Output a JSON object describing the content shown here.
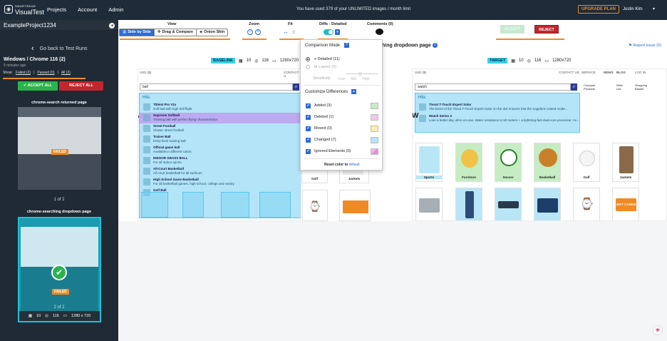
{
  "app": {
    "logo_small": "SMARTBEAR",
    "logo_big": "VisualTest",
    "logo_icon": "eye-icon",
    "nav": [
      "Projects",
      "Account",
      "Admin"
    ],
    "usage_text": "You have used 379 of your UNLIMITED images / month limit",
    "upgrade_label": "UPGRADE PLAN",
    "user_name": "Justin Kim",
    "accent": "#2d6bd4",
    "brand_dark": "#1e2b38",
    "warning": "#f08a24",
    "danger": "#c0272d",
    "success": "#2bb24c"
  },
  "sidebar": {
    "project_name": "ExampleProject1234",
    "back_label": "Go back to Test Runs",
    "environment": "Windows / Chrome 116 (2)",
    "time_ago": "5 minutes ago",
    "filter_prefix": "Show:",
    "filter_failed": "Failed (2)",
    "filter_sep": "|",
    "filter_passed": "Passed (0)",
    "filter_all": "All (2)",
    "accept_all": "ACCEPT ALL",
    "reject_all": "REJECT ALL",
    "runs": [
      {
        "title": "chrome-search returned page",
        "status": "FAILED",
        "pager": "1 of 2"
      },
      {
        "title": "chrome-searching dropdown page",
        "status": "FAILED",
        "pager": "2 of 2",
        "stat_a": "10",
        "stat_b": "116",
        "stat_c": "1280 x 720"
      }
    ]
  },
  "toolbar": {
    "view_label": "View",
    "view_side": "Side by Side",
    "view_drag": "Drag & Compare",
    "view_onion": "Onion Skin",
    "zoom_label": "Zoom",
    "zoom_out": "−",
    "zoom_in": "+",
    "fit_label": "Fit",
    "fit_width": "↔",
    "fit_height": "↕",
    "diffs_label": "Diffs - Detailed",
    "comments_label": "Comments (0)",
    "accept_label": "ACCEPT",
    "reject_label": "REJECT"
  },
  "page": {
    "title_fragment": "hing dropdown page",
    "report_issue": "Report Issue (0)"
  },
  "baseline": {
    "tag": "BASELINE",
    "stat_a": "10",
    "stat_b": "116",
    "resolution": "1280x720",
    "nav_left": "USD ($)",
    "nav_right": "CONTACT U",
    "search_value": "ball",
    "hits_title": "Hits",
    "hits": [
      {
        "title": "Titleist Pro V1x",
        "sub": "Golf ball with high ball flight"
      },
      {
        "title": "Supreme Softball",
        "sub": "Training ball with perfect flying characteristics"
      },
      {
        "title": "Street Football",
        "sub": "Classic street football"
      },
      {
        "title": "Trainer Ball",
        "sub": "Entry-level training ball"
      },
      {
        "title": "Official game ball",
        "sub": "Available in different colors"
      },
      {
        "title": "INDOOR GRASS BALL",
        "sub": "For all indoor sports"
      },
      {
        "title": "All-Court Basketball",
        "sub": "All-court basketball for all surfaces"
      },
      {
        "title": "High School Game Basketball",
        "sub": "For all basketball games, high school, college and varsity"
      },
      {
        "title": "Golf Ball",
        "sub": ""
      }
    ],
    "products_row": [
      "Golf",
      "Jackets"
    ]
  },
  "target": {
    "tag": "TARGET",
    "stat_a": "10",
    "stat_b": "116",
    "resolution": "1280x720",
    "nav_left": "USD ($)",
    "nav_items": [
      "CONTACT US",
      "SERVICE",
      "NEWS",
      "BLOG",
      "LOG IN"
    ],
    "search_value": "watch",
    "compare_label": "Compare Products",
    "wish_label": "Wish List",
    "cart_label": "Shopping Basket",
    "hits_title": "Hits",
    "hits": [
      {
        "title": "Tissot T-Touch Expert Solar",
        "sub": "The bezel of the Tissot T-Touch Expert Solar on the dial ensures that the Sapphire-coated mode..."
      },
      {
        "title": "Watch Series 3",
        "sub": "Lose a better day, all-in-on-one. Water resistance to 50 meters + a lightning-fast dual-core processor. An..."
      }
    ],
    "products_row1": [
      "Sports",
      "Furniture",
      "Soccer",
      "Basketball",
      "Golf",
      "Jackets"
    ],
    "products_row2": [
      "",
      "",
      "",
      "",
      "",
      "GIFT CARDS"
    ]
  },
  "dropdown": {
    "title": "Comparison Mode",
    "help": "?",
    "mode_detailed": "Detailed (11)",
    "mode_layout": "Layout (0)",
    "sensitivity": "Sensitivity",
    "sens_levels": [
      "Low",
      "Mid",
      "High"
    ],
    "customize": "Customize Differences",
    "items": [
      {
        "label": "Added (3)",
        "color": "#c6ecc3"
      },
      {
        "label": "Deleted (1)",
        "color": "#f7c4ea"
      },
      {
        "label": "Moved (0)",
        "color": "#fcefae"
      },
      {
        "label": "Changed (7)",
        "color": "#b7e6f8"
      },
      {
        "label": "Ignored Elements (0)",
        "color": "#e58ce0"
      }
    ],
    "reset_prefix": "Reset color to",
    "reset_link": "default"
  }
}
